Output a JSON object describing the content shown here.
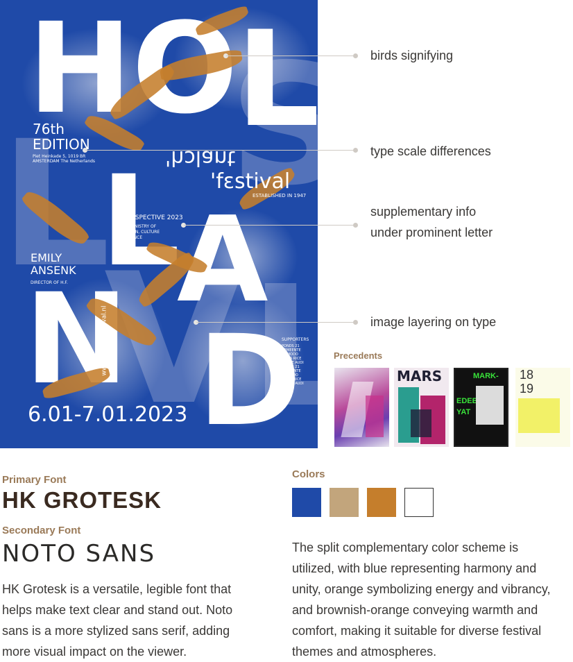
{
  "poster": {
    "letters": {
      "l1": "H",
      "l2": "O",
      "l3": "L",
      "l4": "L",
      "l5": "A",
      "l6": "N",
      "l7": "D"
    },
    "edition_line1": "76th",
    "edition_line2": "EDITION",
    "address_line1": "Piet Heinkade 5, 1019 BR",
    "address_line2": "AMSTERDAM The Netherlands",
    "logo_holland": "'hɔlant",
    "logo_festival": "'fɛstival",
    "established": "ESTABLISHED IN 1947",
    "retro_title": "RETROSPECTIVE 2023",
    "retro_line1": "DUTCH MINISTRY OF",
    "retro_line2": "EDUCATION, CULTURE",
    "retro_line3": "AND SCIENCE",
    "director_name1": "EMILY",
    "director_name2": "ANSENK",
    "director_role": "DIRECTOR OF H.F.",
    "website": "www.hollandfestival.nl",
    "dates": "6.01-7.01.2023",
    "supporters_title": "SUPPORTERS",
    "supporters": [
      "PONDS 21",
      "GEMEENTE",
      "AMMODO",
      "EMMA RICE",
      "PIERRE AUDI",
      "PONDS 21",
      "GEMEENTE",
      "AMMODO",
      "EMMA RICE",
      "PIERRE AUDI"
    ]
  },
  "annotations": {
    "a1": "birds signifying",
    "a2": "type scale differences",
    "a3_line1": "supplementary info",
    "a3_line2": "under prominent letter",
    "a4": "image layering on type"
  },
  "precedents": {
    "title": "Precedents",
    "p2_text": "MARS",
    "p3_line1": "MARK-",
    "p3_line2": "EDEBI",
    "p3_line3": "YAT",
    "p4_line1": "18",
    "p4_line2": "19"
  },
  "fonts": {
    "primary_label": "Primary Font",
    "primary_name": "HK GROTESK",
    "secondary_label": "Secondary Font",
    "secondary_name": "NOTO SANS",
    "description": [
      "HK Grotesk is a versatile, legible font that",
      "helps make text clear and stand out. Noto",
      "sans is a more stylized sans serif, adding",
      "more visual impact on the viewer."
    ]
  },
  "colors": {
    "label": "Colors",
    "swatches": [
      "#1f4aa8",
      "#c2a57c",
      "#c57e2c",
      "#ffffff"
    ],
    "description": [
      "The split complementary color scheme is",
      "utilized, with blue representing harmony and",
      "unity, orange symbolizing energy and vibrancy,",
      "and brownish-orange conveying warmth and",
      "comfort, making it suitable for diverse festival",
      "themes and atmospheres."
    ]
  }
}
